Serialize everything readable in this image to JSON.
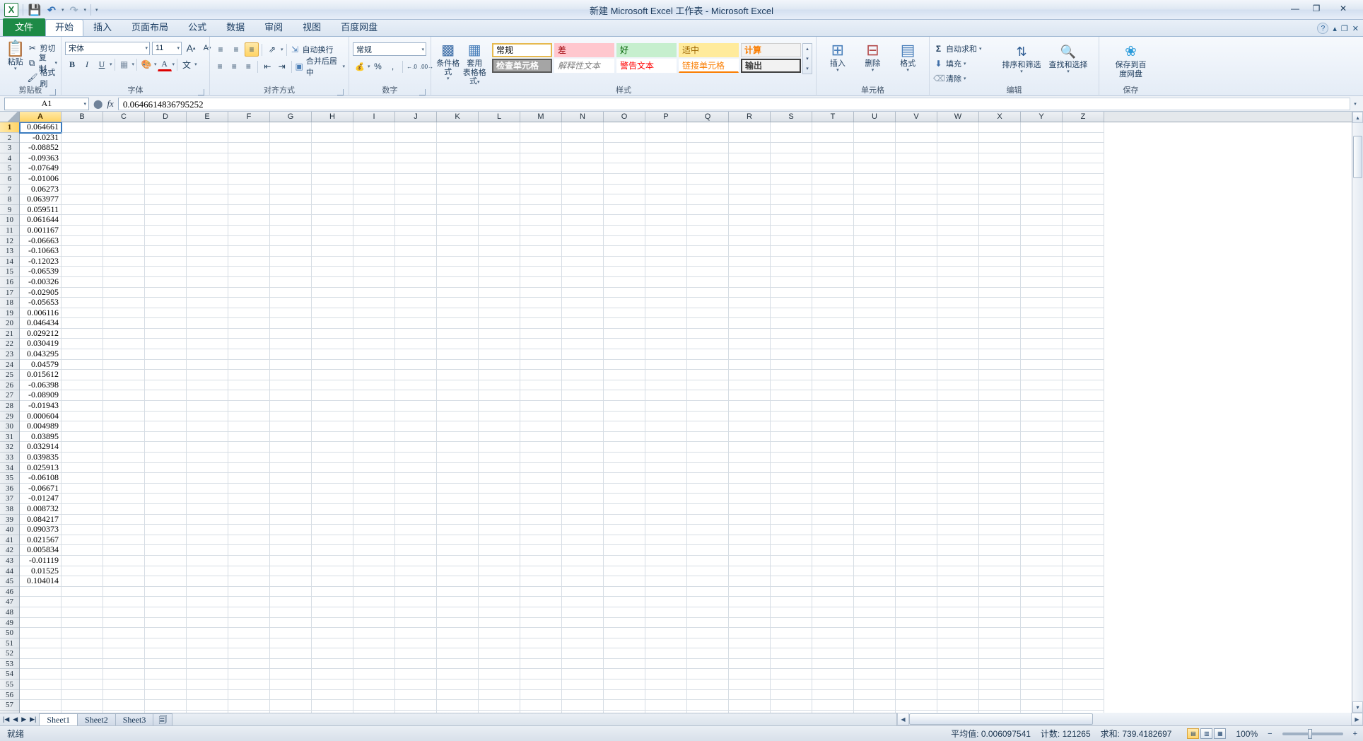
{
  "titlebar": {
    "title": "新建 Microsoft Excel 工作表  -  Microsoft Excel",
    "logo": "X",
    "quick_access": [
      {
        "name": "save",
        "glyph": "💾"
      },
      {
        "name": "undo",
        "glyph": "↶"
      },
      {
        "name": "redo",
        "glyph": "↷"
      },
      {
        "name": "customize",
        "glyph": "▾"
      }
    ],
    "window_controls": {
      "minimize": "—",
      "maximize": "❐",
      "close": "✕"
    }
  },
  "tabs": {
    "items": [
      "文件",
      "开始",
      "插入",
      "页面布局",
      "公式",
      "数据",
      "审阅",
      "视图",
      "百度网盘"
    ],
    "active": "开始",
    "help": "?"
  },
  "ribbon": {
    "clipboard": {
      "label": "剪贴板",
      "paste": "粘贴",
      "cut": "剪切",
      "copy": "复制",
      "format_painter": "格式刷"
    },
    "font": {
      "label": "字体",
      "font_name": "宋体",
      "font_size": "11",
      "grow": "A",
      "shrink": "A",
      "bold": "B",
      "italic": "I",
      "underline": "U",
      "border": "▦",
      "fill": "▒",
      "color": "A",
      "phonetic": "文"
    },
    "alignment": {
      "label": "对齐方式",
      "align_top": "≡",
      "align_middle": "≡",
      "align_bottom": "≡",
      "orientation": "⤰",
      "wrap_text": "自动换行",
      "align_left": "≡",
      "align_center": "≡",
      "align_right": "≡",
      "decrease_indent": "⇤",
      "increase_indent": "⇥",
      "merge_center": "合并后居中"
    },
    "number": {
      "label": "数字",
      "format": "常规",
      "currency": "💰",
      "percent": "%",
      "comma": ",",
      "increase_decimal": ".00",
      "decrease_decimal": ".0"
    },
    "styles": {
      "label": "样式",
      "conditional_formatting": "条件格式",
      "format_as_table": "套用\n表格格式",
      "format_as_table_l1": "套用",
      "format_as_table_l2": "表格格式",
      "cell_styles": [
        {
          "name": "normal",
          "label": "常规"
        },
        {
          "name": "bad",
          "label": "差"
        },
        {
          "name": "good",
          "label": "好"
        },
        {
          "name": "neutral",
          "label": "适中"
        },
        {
          "name": "calculation",
          "label": "计算"
        },
        {
          "name": "check-cell",
          "label": "检查单元格"
        },
        {
          "name": "explanatory",
          "label": "解释性文本"
        },
        {
          "name": "warning",
          "label": "警告文本"
        },
        {
          "name": "linked-cell",
          "label": "链接单元格"
        },
        {
          "name": "output",
          "label": "输出"
        }
      ]
    },
    "cells": {
      "label": "单元格",
      "insert": "插入",
      "delete": "删除",
      "format": "格式"
    },
    "editing": {
      "label": "编辑",
      "autosum": "自动求和",
      "fill": "填充",
      "clear": "清除",
      "sort_filter": "排序和筛选",
      "find_select": "查找和选择"
    },
    "save_group": {
      "label": "保存",
      "line1": "保存到百",
      "line2": "度网盘"
    }
  },
  "formula_bar": {
    "name_box": "A1",
    "fx": "fx",
    "cancel": "✕",
    "enter": "✓",
    "value": "0.0646614836795252"
  },
  "grid": {
    "columns": [
      "A",
      "B",
      "C",
      "D",
      "E",
      "F",
      "G",
      "H",
      "I",
      "J",
      "K",
      "L",
      "M",
      "N",
      "O",
      "P",
      "Q",
      "R",
      "S",
      "T",
      "U",
      "V",
      "W",
      "X",
      "Y",
      "Z"
    ],
    "selected_column": "A",
    "selected_row": 1,
    "column_a_values": [
      "0.064661",
      "-0.0231",
      "-0.08852",
      "-0.09363",
      "-0.07649",
      "-0.01006",
      "0.06273",
      "0.063977",
      "0.059511",
      "0.061644",
      "0.001167",
      "-0.06663",
      "-0.10663",
      "-0.12023",
      "-0.06539",
      "-0.00326",
      "-0.02905",
      "-0.05653",
      "0.006116",
      "0.046434",
      "0.029212",
      "0.030419",
      "0.043295",
      "0.04579",
      "0.015612",
      "-0.06398",
      "-0.08909",
      "-0.01943",
      "0.000604",
      "0.004989",
      "0.03895",
      "0.032914",
      "0.039835",
      "0.025913",
      "-0.06108",
      "-0.06671",
      "-0.01247",
      "0.008732",
      "0.084217",
      "0.090373",
      "0.021567",
      "0.005834",
      "-0.01119",
      "0.01525",
      "0.104014"
    ]
  },
  "sheet_tabs": {
    "items": [
      "Sheet1",
      "Sheet2",
      "Sheet3"
    ],
    "active": "Sheet1",
    "insert_sheet_icon": "insert-worksheet-icon",
    "nav": {
      "first": "⏮",
      "prev": "◀",
      "next": "▶",
      "last": "⏭"
    }
  },
  "status_bar": {
    "ready": "就绪",
    "average_label": "平均值:",
    "average_value": "0.006097541",
    "count_label": "计数:",
    "count_value": "121265",
    "sum_label": "求和:",
    "sum_value": "739.4182697",
    "zoom": "100%",
    "zoom_out": "−",
    "zoom_in": "+",
    "views": [
      {
        "name": "normal-view",
        "glyph": "▤"
      },
      {
        "name": "page-layout-view",
        "glyph": "▥"
      },
      {
        "name": "page-break-view",
        "glyph": "▦"
      }
    ]
  },
  "colors": {
    "accent_green": "#1d8a46",
    "selection_blue": "#3a7bbf",
    "header_gold": "#ffd465"
  }
}
